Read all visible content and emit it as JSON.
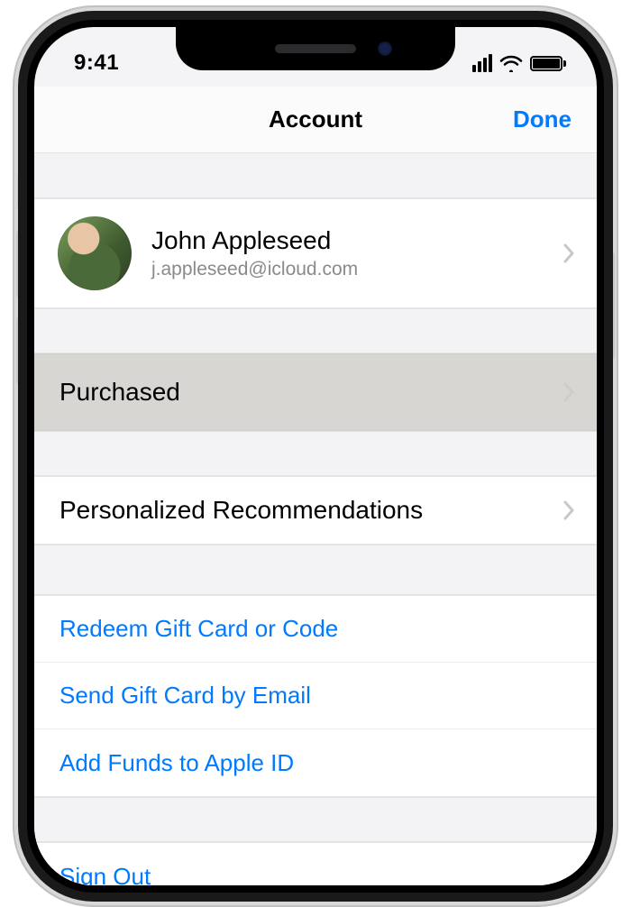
{
  "status": {
    "time": "9:41"
  },
  "nav": {
    "title": "Account",
    "done": "Done"
  },
  "profile": {
    "name": "John Appleseed",
    "email": "j.appleseed@icloud.com"
  },
  "rows": {
    "purchased": "Purchased",
    "recommendations": "Personalized Recommendations"
  },
  "links": {
    "redeem": "Redeem Gift Card or Code",
    "send": "Send Gift Card by Email",
    "addFunds": "Add Funds to Apple ID",
    "signOut": "Sign Out"
  }
}
